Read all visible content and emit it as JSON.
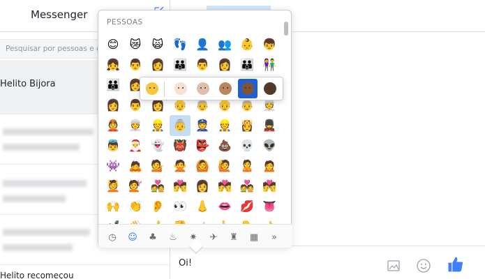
{
  "sidebar": {
    "title": "Messenger",
    "search_placeholder": "Pesquisar por pessoas e grupos",
    "conversations": [
      {
        "name": "Helito Bijora"
      },
      {
        "name": ""
      },
      {
        "name": ""
      },
      {
        "name": ""
      },
      {
        "name": "Helito recomeçou"
      }
    ]
  },
  "chat": {
    "message_text": "Oi!"
  },
  "picker": {
    "category_title": "PESSOAS",
    "rows": [
      [
        "😊",
        "😿",
        "🙀",
        "👣",
        "👤",
        "👥",
        "👶",
        "👦"
      ],
      [
        "👧",
        "👨",
        "👩",
        "👪",
        "👨",
        "👩",
        "👪",
        "👫"
      ],
      [
        "👪",
        "👩",
        "👨",
        "👬",
        "👭",
        "👪",
        "👨",
        "👩"
      ],
      [
        "👩",
        "👨",
        "👩",
        "👴",
        "👵",
        "👴",
        "👵",
        "👳"
      ],
      [
        "👲",
        "👳",
        "👷",
        "👵",
        "👮",
        "👷",
        "👸",
        "💂"
      ],
      [
        "👼",
        "🎅",
        "👻",
        "👹",
        "👺",
        "💩",
        "💀",
        "👽"
      ],
      [
        "👾",
        "🙇",
        "💁",
        "🙅",
        "🙆",
        "🙋",
        "🙎",
        "🙍"
      ],
      [
        "💆",
        "💇",
        "💑",
        "💏",
        "👩",
        "💏",
        "💑",
        "💏"
      ],
      [
        "🙌",
        "👏",
        "👂",
        "👀",
        "👃",
        "👄",
        "💋",
        "👅"
      ],
      [
        "💅",
        "👋",
        "👍",
        "👎",
        "☝",
        "👆",
        "👇",
        "👈"
      ],
      [
        "👉",
        "👌",
        "✌",
        "👊",
        "✊",
        "✋",
        "💪",
        "👐"
      ]
    ],
    "selected_row": 4,
    "selected_col": 3,
    "tabs": [
      {
        "icon": "clock-icon",
        "glyph": "◷",
        "active": false
      },
      {
        "icon": "smiley-icon",
        "glyph": "☺",
        "active": true
      },
      {
        "icon": "tree-icon",
        "glyph": "♣",
        "active": false
      },
      {
        "icon": "cake-icon",
        "glyph": "♨",
        "active": false
      },
      {
        "icon": "party-icon",
        "glyph": "✷",
        "active": false
      },
      {
        "icon": "runner-icon",
        "glyph": "✈",
        "active": false
      },
      {
        "icon": "car-icon",
        "glyph": "♜",
        "active": false
      },
      {
        "icon": "symbols-icon",
        "glyph": "▦",
        "active": false
      },
      {
        "icon": "more-icon",
        "glyph": "»",
        "active": false
      }
    ]
  },
  "skin_tones": {
    "options": [
      "#f7c63c",
      "#f6e1d5",
      "#dfbfaa",
      "#b8865f",
      "#7e5538",
      "#553a2b"
    ],
    "selected": 4
  },
  "colors": {
    "accent": "#1e78e6",
    "like_blue": "#4080ff"
  }
}
